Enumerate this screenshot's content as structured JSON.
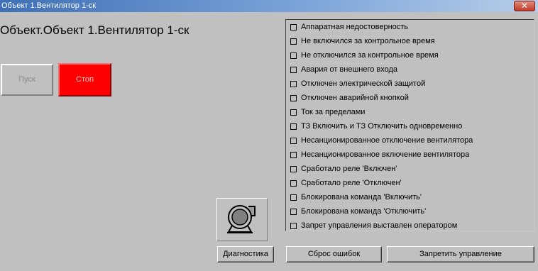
{
  "window": {
    "title": "Объект 1.Вентилятор 1-ск",
    "close_glyph": "✕"
  },
  "object_title": "Объект.Объект 1.Вентилятор 1-ск",
  "controls": {
    "start_label": "Пуск",
    "stop_label": "Стоп"
  },
  "status_items": [
    {
      "label": "Аппаратная недостоверность",
      "checked": false
    },
    {
      "label": "Не включился за контрольное время",
      "checked": false
    },
    {
      "label": "Не отключился за контрольное время",
      "checked": false
    },
    {
      "label": "Авария от внешнего входа",
      "checked": false
    },
    {
      "label": "Отключен электрической защитой",
      "checked": false
    },
    {
      "label": "Отключен аварийной кнопкой",
      "checked": false
    },
    {
      "label": "Ток за пределами",
      "checked": false
    },
    {
      "label": "ТЗ Включить и ТЗ Отключить одновременно",
      "checked": false
    },
    {
      "label": "Несанционированное отключение вентилятора",
      "checked": false
    },
    {
      "label": "Несанционированное включение вентилятора",
      "checked": false
    },
    {
      "label": "Сработало реле 'Включен'",
      "checked": false
    },
    {
      "label": "Сработало реле 'Отключен'",
      "checked": false
    },
    {
      "label": "Блокирована команда 'Включить'",
      "checked": false
    },
    {
      "label": "Блокирована команда 'Отключить'",
      "checked": false
    },
    {
      "label": "Запрет управления выставлен оператором",
      "checked": false
    }
  ],
  "footer": {
    "diagnostics_label": "Диагностика",
    "reset_errors_label": "Сброс ошибок",
    "block_control_label": "Запретить управление"
  },
  "colors": {
    "window_bg": "#c0c0c0",
    "stop_button": "#ff0000",
    "titlebar_start": "#3f6fb6",
    "titlebar_end": "#b7cde9"
  },
  "icons": {
    "fan": "fan-icon",
    "close": "close-icon"
  }
}
